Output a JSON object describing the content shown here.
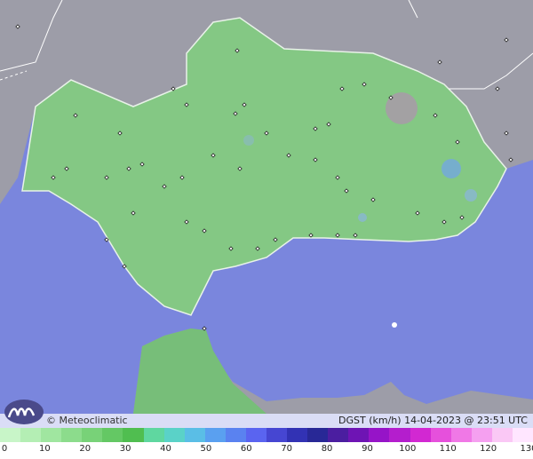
{
  "map": {
    "sea_color": "#7a86dd",
    "land_color": "#84c884",
    "neighbor_land_color": "#9b9ba5",
    "border_color": "#ffffff"
  },
  "footer": {
    "copyright": "© Meteoclimatic",
    "caption": "DGST (km/h)  14-04-2023 @ 23:51 UTC"
  },
  "scale": {
    "labels": [
      "0",
      "10",
      "20",
      "30",
      "40",
      "50",
      "60",
      "70",
      "80",
      "90",
      "100",
      "110",
      "120",
      "130"
    ],
    "colors": [
      "#c8f5c8",
      "#b4eeb4",
      "#a0e6a0",
      "#8cdc8c",
      "#78d278",
      "#64c864",
      "#50be50",
      "#5fd7a0",
      "#5ad2c8",
      "#5abee6",
      "#5aa0f0",
      "#5a82f0",
      "#5a64f0",
      "#4646d2",
      "#3232b4",
      "#282896",
      "#4b1ea0",
      "#6e14b4",
      "#9614c8",
      "#b41ecd",
      "#d228d2",
      "#e650dc",
      "#f078e6",
      "#f5a0f0",
      "#fac8f5",
      "#ffe6ff"
    ]
  }
}
